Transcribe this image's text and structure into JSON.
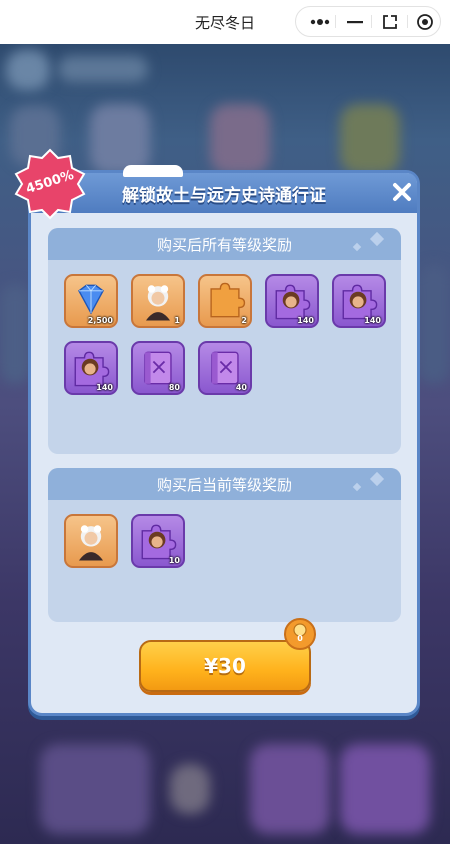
{
  "app": {
    "title": "无尽冬日"
  },
  "dialog": {
    "title": "解锁故土与远方史诗通行证",
    "discount": "4500%",
    "all_levels": {
      "title": "购买后所有等级奖励",
      "items": [
        {
          "icon": "diamond-icon",
          "style": "orange",
          "qty": "2,500"
        },
        {
          "icon": "hero-portrait-icon",
          "style": "orange",
          "qty": "1"
        },
        {
          "icon": "puzzle-piece-icon",
          "style": "orange",
          "qty": "2"
        },
        {
          "icon": "hero-shard-icon",
          "style": "purple",
          "qty": "140"
        },
        {
          "icon": "hero-shard-icon",
          "style": "purple",
          "qty": "140"
        },
        {
          "icon": "hero-shard-icon",
          "style": "purple",
          "qty": "140"
        },
        {
          "icon": "skill-book-icon",
          "style": "purple",
          "qty": "80"
        },
        {
          "icon": "skill-book-icon",
          "style": "purple",
          "qty": "40"
        }
      ]
    },
    "current_level": {
      "title": "购买后当前等级奖励",
      "items": [
        {
          "icon": "hero-portrait-icon",
          "style": "orange",
          "qty": ""
        },
        {
          "icon": "hero-shard-icon",
          "style": "purple",
          "qty": "10"
        }
      ]
    },
    "price": "¥30",
    "bonus_count": "0"
  },
  "colors": {
    "accent": "#ffb21c",
    "panel": "#dfe8f5",
    "header": "#5a86c7",
    "discount": "#e8446a"
  }
}
